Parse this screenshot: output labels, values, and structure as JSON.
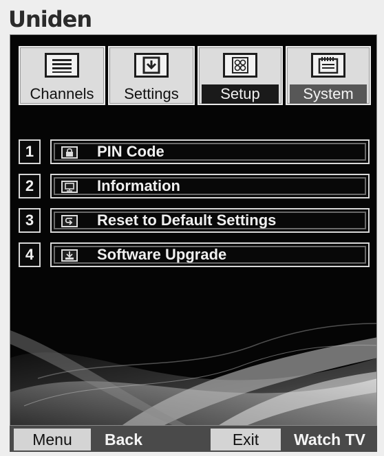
{
  "brand": {
    "name": "Uniden"
  },
  "tabs": [
    {
      "label": "Channels",
      "icon": "list-icon"
    },
    {
      "label": "Settings",
      "icon": "download-box-icon"
    },
    {
      "label": "Setup",
      "icon": "grid-icon"
    },
    {
      "label": "System",
      "icon": "calendar-icon"
    }
  ],
  "menu": [
    {
      "number": "1",
      "label": "PIN Code",
      "icon": "lock-icon"
    },
    {
      "number": "2",
      "label": "Information",
      "icon": "monitor-icon"
    },
    {
      "number": "3",
      "label": "Reset to Default Settings",
      "icon": "reset-arrow-icon"
    },
    {
      "number": "4",
      "label": "Software Upgrade",
      "icon": "upgrade-icon"
    }
  ],
  "bottom_bar": {
    "menu": "Menu",
    "back": "Back",
    "exit": "Exit",
    "watch_tv": "Watch TV"
  }
}
